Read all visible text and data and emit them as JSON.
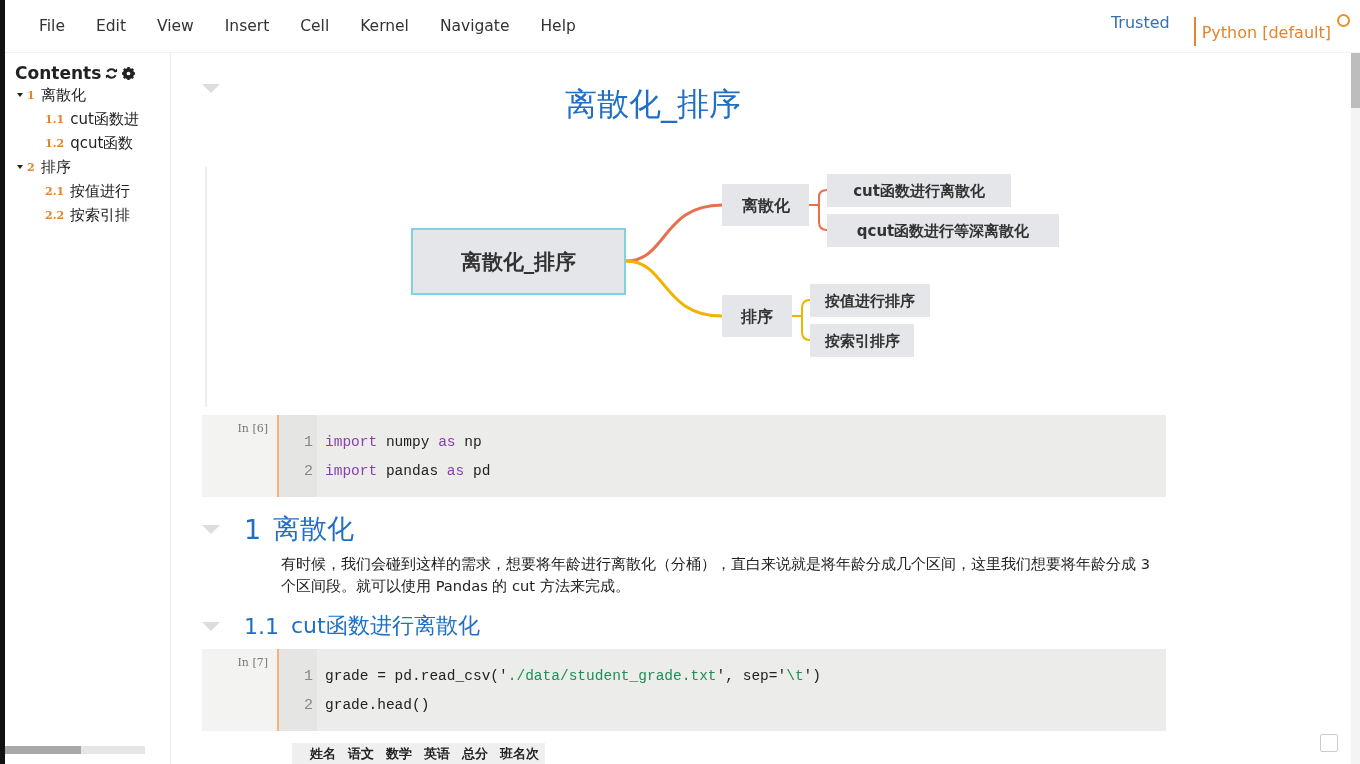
{
  "menu": [
    "File",
    "Edit",
    "View",
    "Insert",
    "Cell",
    "Kernel",
    "Navigate",
    "Help"
  ],
  "kernel": {
    "trusted": "Trusted",
    "name": "Python [default]",
    "busy": false
  },
  "toc": {
    "title": "Contents",
    "items": [
      {
        "number": "1",
        "label": "离散化",
        "expanded": true,
        "children": [
          {
            "number": "1.1",
            "label": "cut函数进"
          },
          {
            "number": "1.2",
            "label": "qcut函数"
          }
        ]
      },
      {
        "number": "2",
        "label": "排序",
        "expanded": true,
        "children": [
          {
            "number": "2.1",
            "label": "按值进行"
          },
          {
            "number": "2.2",
            "label": "按索引排"
          }
        ]
      }
    ]
  },
  "cells": [
    {
      "kind": "title",
      "text": "离散化_排序",
      "mindmap": {
        "root": "离散化_排序",
        "branches": [
          {
            "label": "离散化",
            "color": "#e8704f",
            "children": [
              "cut函数进行离散化",
              "qcut函数进行等深离散化"
            ]
          },
          {
            "label": "排序",
            "color": "#f0b400",
            "children": [
              "按值进行排序",
              "按索引排序"
            ]
          }
        ]
      }
    },
    {
      "kind": "code",
      "prompt": "In [6]",
      "lines": [
        {
          "number": "1",
          "tokens": [
            {
              "text": "import",
              "kind": "keyword"
            },
            {
              "text": " numpy ",
              "kind": "plain"
            },
            {
              "text": "as",
              "kind": "keyword"
            },
            {
              "text": " np",
              "kind": "plain"
            }
          ]
        },
        {
          "number": "2",
          "tokens": [
            {
              "text": "import",
              "kind": "keyword"
            },
            {
              "text": " pandas ",
              "kind": "plain"
            },
            {
              "text": "as",
              "kind": "keyword"
            },
            {
              "text": " pd",
              "kind": "plain"
            }
          ]
        }
      ]
    },
    {
      "kind": "heading1",
      "number": "1",
      "text": "离散化"
    },
    {
      "kind": "text",
      "text": "有时候，我们会碰到这样的需求，想要将年龄进行离散化（分桶），直白来说就是将年龄分成几个区间，这里我们想要将年龄分成 3 个区间段。就可以使用 Pandas 的 cut 方法来完成。"
    },
    {
      "kind": "heading2",
      "number": "1.1",
      "text": "cut函数进行离散化"
    },
    {
      "kind": "code",
      "prompt": "In [7]",
      "lines": [
        {
          "number": "1",
          "tokens": [
            {
              "text": "grade = pd.read_csv('",
              "kind": "plain"
            },
            {
              "text": "./data/student_grade.txt",
              "kind": "string"
            },
            {
              "text": "', sep='",
              "kind": "plain"
            },
            {
              "text": "\\t",
              "kind": "string"
            },
            {
              "text": "')",
              "kind": "plain"
            }
          ]
        },
        {
          "number": "2",
          "tokens": [
            {
              "text": "grade.head()",
              "kind": "plain"
            }
          ]
        }
      ]
    },
    {
      "kind": "table",
      "columns": [
        "姓名",
        "语文",
        "数学",
        "英语",
        "总分",
        "班名次"
      ]
    }
  ]
}
